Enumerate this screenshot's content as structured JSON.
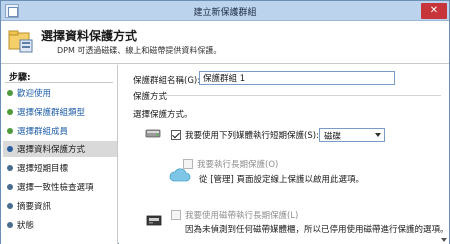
{
  "window": {
    "title": "建立新保護群組",
    "close_glyph": "✕"
  },
  "header": {
    "title": "選擇資料保護方式",
    "description": "DPM 可透過磁碟、線上和磁帶提供資料保護。"
  },
  "steps": {
    "title": "步驟:",
    "items": [
      {
        "label": "歡迎使用"
      },
      {
        "label": "選擇保護群組類型"
      },
      {
        "label": "選擇群組成員"
      },
      {
        "label": "選擇資料保護方式"
      },
      {
        "label": "選擇短期目標"
      },
      {
        "label": "選擇一致性檢查選項"
      },
      {
        "label": "摘要資訊"
      },
      {
        "label": "狀態"
      }
    ]
  },
  "form": {
    "group_name_label": "保護群組名稱(G):",
    "group_name_value": "保護群組 1",
    "protection_method_title": "保護方式",
    "choose_label": "選擇保護方式。",
    "short_term": {
      "label": "我要使用下列媒體執行短期保護(S):",
      "checked": true,
      "selected": "磁碟"
    },
    "online": {
      "label": "我要執行長期保護(O)",
      "checked": false,
      "note": "從 [管理] 頁面設定線上保護以啟用此選項。"
    },
    "tape": {
      "label": "我要使用磁帶執行長期保護(L)",
      "checked": false,
      "note": "因為未偵測到任何磁帶媒體櫃，所以已停用使用磁帶進行保護的選項。"
    }
  },
  "icons": {
    "app": "wizard-app-icon",
    "header": "protection-group-icon",
    "disk": "disk-drive-icon",
    "cloud": "cloud-icon",
    "tape": "tape-library-icon"
  },
  "colors": {
    "titlebar": "#bcd3ee",
    "link": "#1f5ea8",
    "step_dot": "#4f9a3b",
    "current_step_bg": "#d9d9d9",
    "close": "#c7353a"
  }
}
